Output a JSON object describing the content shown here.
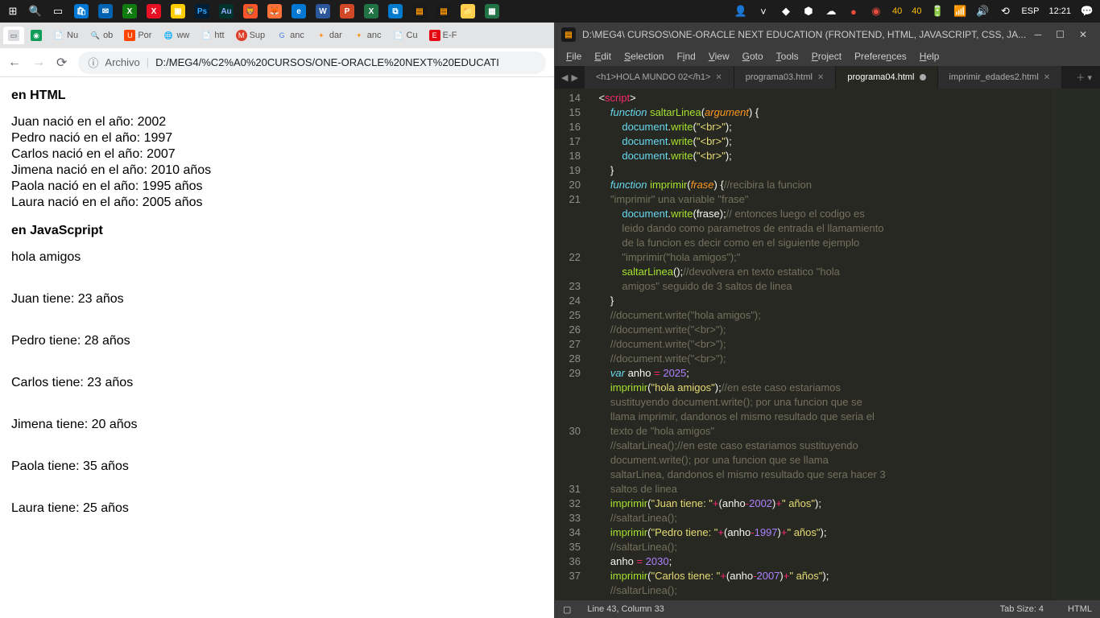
{
  "taskbar": {
    "right": {
      "num1": "40",
      "num2": "40",
      "lang": "ESP",
      "time": "12:21"
    }
  },
  "browser": {
    "tabs": [
      {
        "label": ""
      },
      {
        "label": ""
      },
      {
        "label": "Nu"
      },
      {
        "label": "ob"
      },
      {
        "label": "Por"
      },
      {
        "label": "ww"
      },
      {
        "label": "htt"
      },
      {
        "label": "Sup"
      },
      {
        "label": "anc"
      },
      {
        "label": "dar"
      },
      {
        "label": "anc"
      },
      {
        "label": "Cu"
      },
      {
        "label": "E-F"
      }
    ],
    "url_label": "Archivo",
    "url": "D:/MEG4/%C2%A0%20CURSOS/ONE-ORACLE%20NEXT%20EDUCATI",
    "content": {
      "h1": "en HTML",
      "lines1": [
        "Juan nació en el año: 2002",
        "Pedro nació en el año: 1997",
        "Carlos nació en el año: 2007",
        "Jimena nació en el año: 2010 años",
        "Paola nació en el año: 1995 años",
        "Laura nació en el año: 2005 años"
      ],
      "h2": "en JavaScpript",
      "line2": "hola amigos",
      "lines3": [
        "Juan tiene: 23 años",
        "Pedro tiene: 28 años",
        "Carlos tiene: 23 años",
        "Jimena tiene: 20 años",
        "Paola tiene: 35 años",
        "Laura tiene: 25 años"
      ]
    }
  },
  "sublime": {
    "title": "D:\\MEG4\\  CURSOS\\ONE-ORACLE NEXT EDUCATION (FRONTEND, HTML, JAVASCRIPT, CSS, JA...",
    "menu": [
      "File",
      "Edit",
      "Selection",
      "Find",
      "View",
      "Goto",
      "Tools",
      "Project",
      "Preferences",
      "Help"
    ],
    "tabs": [
      {
        "label": "<h1>HOLA MUNDO 02</h1>",
        "active": false,
        "close": true
      },
      {
        "label": "programa03.html",
        "active": false,
        "close": true
      },
      {
        "label": "programa04.html",
        "active": true,
        "close": false
      },
      {
        "label": "imprimir_edades2.html",
        "active": false,
        "close": true
      }
    ],
    "status": {
      "pos": "Line 43, Column 33",
      "tabsize": "Tab Size: 4",
      "syntax": "HTML"
    }
  }
}
